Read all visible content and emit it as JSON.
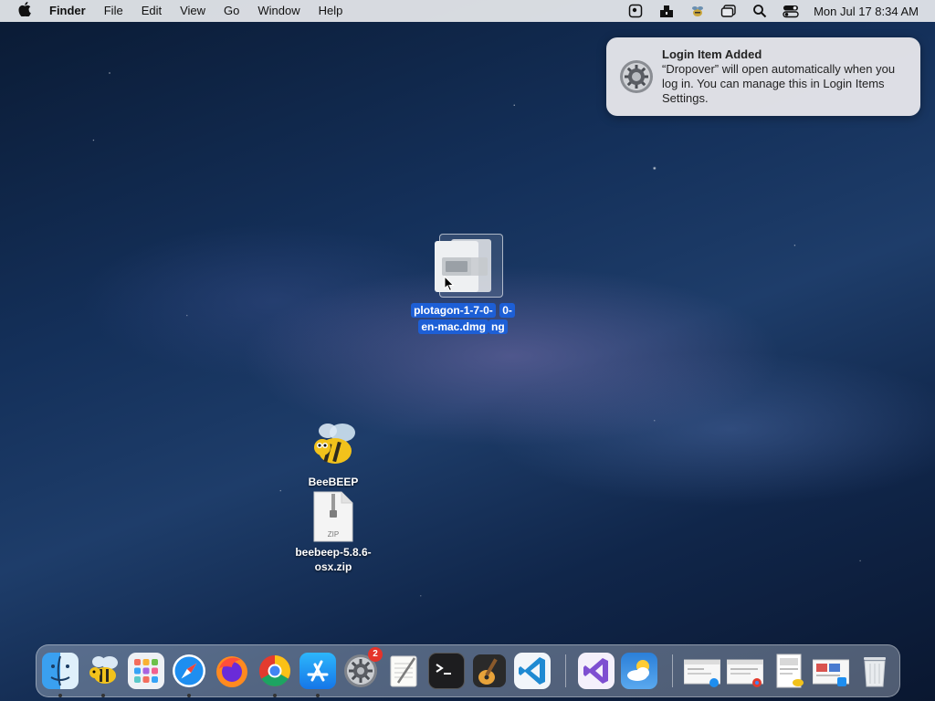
{
  "menubar": {
    "app_name": "Finder",
    "menus": [
      "File",
      "Edit",
      "View",
      "Go",
      "Window",
      "Help"
    ],
    "clock": "Mon Jul 17  8:34 AM",
    "status_icons": [
      "screen-record-icon",
      "dropover-icon",
      "beebeep-menu-icon",
      "window-icon",
      "search-icon",
      "control-center-icon"
    ]
  },
  "notification": {
    "title": "Login Item Added",
    "body": "“Dropover” will open automatically when you log in. You can manage this in Login Items Settings.",
    "icon": "system-settings-gear-icon"
  },
  "desktop": {
    "dmg_label_line1": "plotagon-1-7-0-",
    "dmg_label_line2": "en-mac.dmg",
    "dmg_label_ghost1": "0-",
    "dmg_label_ghost2": "ng",
    "beebeep_label": "BeeBEEP",
    "zip_label_line1": "beebeep-5.8.6-",
    "zip_label_line2": "osx.zip",
    "zip_badge": "ZIP"
  },
  "dock": {
    "settings_badge": "2",
    "apps": [
      "finder-icon",
      "beebeep-icon",
      "launchpad-icon",
      "safari-icon",
      "firefox-icon",
      "chrome-icon",
      "app-store-icon",
      "system-settings-icon",
      "textedit-icon",
      "terminal-icon",
      "garageband-icon",
      "vscode-icon",
      "visual-studio-icon",
      "weather-icon",
      "safari-window-thumb",
      "chrome-window-thumb",
      "preview-window-thumb",
      "app-store-window-thumb",
      "trash-icon"
    ]
  },
  "colors": {
    "selection_blue": "#1d5fd6",
    "menubar_bg": "#e8eaee",
    "badge_red": "#e5332a"
  }
}
